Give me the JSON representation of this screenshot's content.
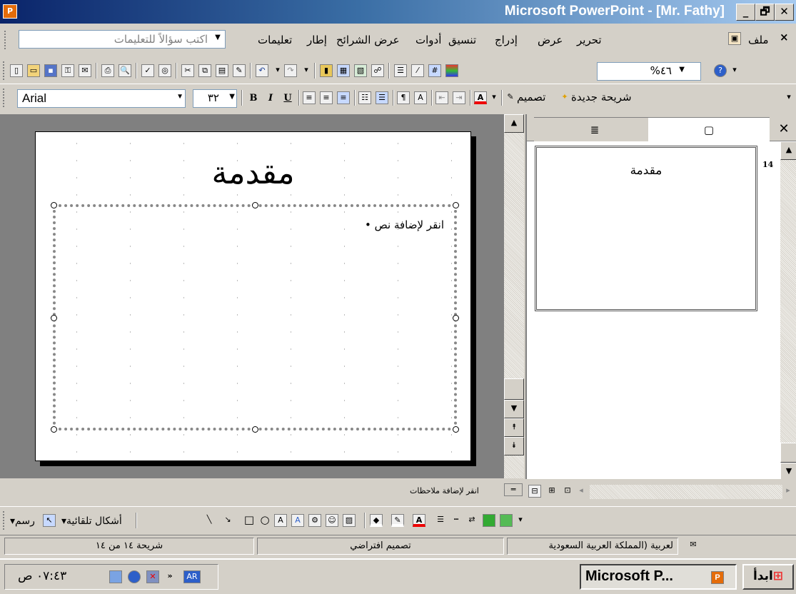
{
  "window": {
    "title": "Microsoft PowerPoint - [Mr. Fathy]",
    "app_icon": "powerpoint-icon",
    "minimize": "_",
    "maximize": "🗗",
    "close": "✕"
  },
  "menubar": {
    "items": [
      "ملف",
      "تحرير",
      "عرض",
      "إدراج",
      "تنسيق",
      "أدوات",
      "عرض الشرائح",
      "إطار",
      "تعليمات"
    ],
    "ask_placeholder": "اكتب سؤالاً للتعليمات",
    "close_doc": "×"
  },
  "standard_toolbar": {
    "zoom": "%٤٦"
  },
  "format_toolbar": {
    "font": "Arial",
    "size": "٣٢",
    "bold": "B",
    "italic": "I",
    "underline": "U",
    "new_slide": "شريحة جديدة",
    "design": "تصميم"
  },
  "slide": {
    "title": "مقدمة",
    "body_placeholder": "انقر لإضافة نص"
  },
  "pane": {
    "tab_outline_icon": "outline-icon",
    "tab_slides_icon": "slides-icon",
    "close": "✕",
    "thumb_title": "مقدمة",
    "thumb_number": "14"
  },
  "notes": {
    "placeholder": "انقر لإضافة ملاحظات"
  },
  "drawbar": {
    "draw": "رسم",
    "autoshapes": "أشكال تلقائية"
  },
  "status": {
    "slide_count": "شريحة ١٤ من ١٤",
    "design": "تصميم افتراضي",
    "language": "لعربية (المملكة العربية السعودية"
  },
  "taskbar": {
    "start": "ابدأ",
    "task": "Microsoft P...",
    "clock": "٠٧:٤٣ ص",
    "lang": "AR"
  }
}
